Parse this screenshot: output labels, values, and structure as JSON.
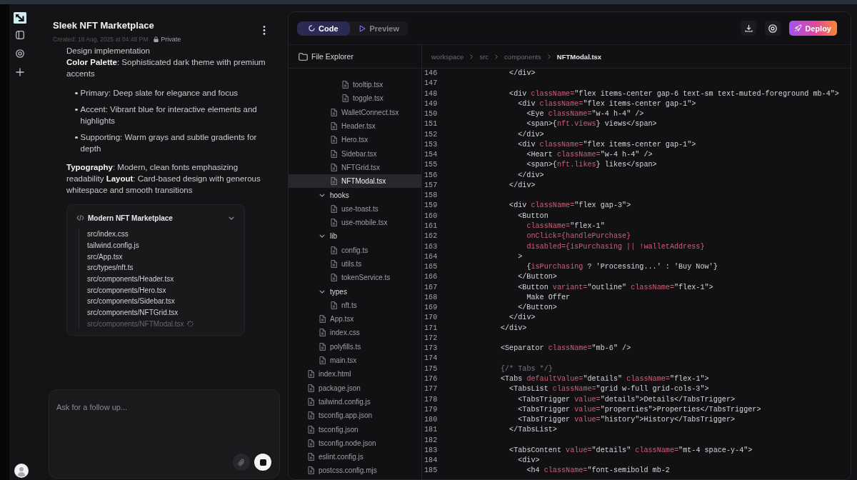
{
  "project": {
    "title": "Sleek NFT Marketplace",
    "created": "Created: 18 Aug, 2025 at 04:48 PM",
    "visibility": "Private"
  },
  "message": {
    "blocks": [
      {
        "kind": "paragraph",
        "text": "Design implementation"
      },
      {
        "kind": "paragraph",
        "text": "**Color Palette**: Sophisticated dark theme with premium accents"
      },
      {
        "kind": "list",
        "items": [
          "Primary: Deep slate for elegance and focus",
          "Accent: Vibrant blue for interactive elements and highlights",
          "Supporting: Warm grays and subtle gradients for depth"
        ]
      },
      {
        "kind": "paragraph",
        "text": "**Typography**: Modern, clean fonts emphasizing readability **Layout**: Card-based design with generous whitespace and smooth transitions"
      }
    ]
  },
  "artifact": {
    "title": "Modern NFT Marketplace",
    "expanded": true,
    "files": [
      {
        "path": "src/index.css",
        "pending": false
      },
      {
        "path": "tailwind.config.js",
        "pending": false
      },
      {
        "path": "src/App.tsx",
        "pending": false
      },
      {
        "path": "src/types/nft.ts",
        "pending": false
      },
      {
        "path": "src/components/Header.tsx",
        "pending": false
      },
      {
        "path": "src/components/Hero.tsx",
        "pending": false
      },
      {
        "path": "src/components/Sidebar.tsx",
        "pending": false
      },
      {
        "path": "src/components/NFTGrid.tsx",
        "pending": false
      },
      {
        "path": "src/components/NFTModal.tsx",
        "pending": true
      }
    ]
  },
  "composer": {
    "placeholder": "Ask for a follow up..."
  },
  "workspace": {
    "tabs": [
      {
        "label": "Code",
        "selected": true
      },
      {
        "label": "Preview",
        "selected": false
      }
    ],
    "deploy": "Deploy"
  },
  "explorer": {
    "title": "File Explorer",
    "tree": [
      {
        "kind": "folder",
        "children": [
          {
            "kind": "folder",
            "children": [
              {
                "kind": "folder",
                "children": [
                  {
                    "kind": "file",
                    "label": "tooltip.tsx",
                    "selected": false
                  },
                  {
                    "kind": "file",
                    "label": "toggle.tsx",
                    "selected": false
                  }
                ]
              },
              {
                "kind": "file",
                "label": "WalletConnect.tsx",
                "selected": false
              },
              {
                "kind": "file",
                "label": "Header.tsx",
                "selected": false
              },
              {
                "kind": "file",
                "label": "Hero.tsx",
                "selected": false
              },
              {
                "kind": "file",
                "label": "Sidebar.tsx",
                "selected": false
              },
              {
                "kind": "file",
                "label": "NFTGrid.tsx",
                "selected": false
              },
              {
                "kind": "file",
                "label": "NFTModal.tsx",
                "selected": true
              }
            ]
          },
          {
            "kind": "folder",
            "label": "hooks",
            "expanded": true,
            "children": [
              {
                "kind": "file",
                "label": "use-toast.ts",
                "selected": false
              },
              {
                "kind": "file",
                "label": "use-mobile.tsx",
                "selected": false
              }
            ]
          },
          {
            "kind": "folder",
            "label": "lib",
            "expanded": true,
            "children": [
              {
                "kind": "file",
                "label": "config.ts",
                "selected": false
              },
              {
                "kind": "file",
                "label": "utils.ts",
                "selected": false
              },
              {
                "kind": "file",
                "label": "tokenService.ts",
                "selected": false
              }
            ]
          },
          {
            "kind": "folder",
            "label": "types",
            "expanded": true,
            "children": [
              {
                "kind": "file",
                "label": "nft.ts",
                "selected": false
              }
            ]
          },
          {
            "kind": "file",
            "label": "App.tsx",
            "selected": false
          },
          {
            "kind": "file",
            "label": "index.css",
            "selected": false
          },
          {
            "kind": "file",
            "label": "polyfills.ts",
            "selected": false
          },
          {
            "kind": "file",
            "label": "main.tsx",
            "selected": false
          }
        ]
      },
      {
        "kind": "file",
        "label": "index.html",
        "selected": false
      },
      {
        "kind": "file",
        "label": "package.json",
        "selected": false
      },
      {
        "kind": "file",
        "label": "tailwind.config.js",
        "selected": false
      },
      {
        "kind": "file",
        "label": "tsconfig.app.json",
        "selected": false
      },
      {
        "kind": "file",
        "label": "tsconfig.json",
        "selected": false
      },
      {
        "kind": "file",
        "label": "tsconfig.node.json",
        "selected": false
      },
      {
        "kind": "file",
        "label": "eslint.config.js",
        "selected": false
      },
      {
        "kind": "file",
        "label": "postcss.config.mjs",
        "selected": false
      }
    ]
  },
  "editor": {
    "breadcrumb": [
      "workspace",
      "src",
      "components",
      "NFTModal.tsx"
    ],
    "lines": [
      {
        "number": "146",
        "tokens": [
          {
            "kind": "plain",
            "text": "              </div>"
          }
        ]
      },
      {
        "number": "147"
      },
      {
        "number": "148",
        "tokens": [
          {
            "kind": "plain",
            "text": "              <div "
          },
          {
            "kind": "attr",
            "text": "className="
          },
          {
            "kind": "plain",
            "text": "\"flex items-center gap-6 text-sm text-muted-foreground mb-4\">"
          }
        ]
      },
      {
        "number": "149",
        "tokens": [
          {
            "kind": "plain",
            "text": "                <div "
          },
          {
            "kind": "attr",
            "text": "className="
          },
          {
            "kind": "plain",
            "text": "\"flex items-center gap-1\">"
          }
        ]
      },
      {
        "number": "150",
        "tokens": [
          {
            "kind": "plain",
            "text": "                  <Eye "
          },
          {
            "kind": "attr",
            "text": "className="
          },
          {
            "kind": "plain",
            "text": "\"w-4 h-4\" />"
          }
        ]
      },
      {
        "number": "151",
        "tokens": [
          {
            "kind": "plain",
            "text": "                  <span>{"
          },
          {
            "kind": "attr",
            "text": "nft.views"
          },
          {
            "kind": "plain",
            "text": "} views</span>"
          }
        ]
      },
      {
        "number": "152",
        "tokens": [
          {
            "kind": "plain",
            "text": "                </div>"
          }
        ]
      },
      {
        "number": "153",
        "tokens": [
          {
            "kind": "plain",
            "text": "                <div "
          },
          {
            "kind": "attr",
            "text": "className="
          },
          {
            "kind": "plain",
            "text": "\"flex items-center gap-1\">"
          }
        ]
      },
      {
        "number": "154",
        "tokens": [
          {
            "kind": "plain",
            "text": "                  <Heart "
          },
          {
            "kind": "attr",
            "text": "className="
          },
          {
            "kind": "plain",
            "text": "\"w-4 h-4\" />"
          }
        ]
      },
      {
        "number": "155",
        "tokens": [
          {
            "kind": "plain",
            "text": "                  <span>{"
          },
          {
            "kind": "attr",
            "text": "nft.likes"
          },
          {
            "kind": "plain",
            "text": "} likes</span>"
          }
        ]
      },
      {
        "number": "156",
        "tokens": [
          {
            "kind": "plain",
            "text": "                </div>"
          }
        ]
      },
      {
        "number": "157",
        "tokens": [
          {
            "kind": "plain",
            "text": "              </div>"
          }
        ]
      },
      {
        "number": "158"
      },
      {
        "number": "159",
        "tokens": [
          {
            "kind": "plain",
            "text": "              <div "
          },
          {
            "kind": "attr",
            "text": "className="
          },
          {
            "kind": "plain",
            "text": "\"flex gap-3\">"
          }
        ]
      },
      {
        "number": "160",
        "tokens": [
          {
            "kind": "plain",
            "text": "                <Button"
          }
        ]
      },
      {
        "number": "161",
        "tokens": [
          {
            "kind": "attr",
            "text": "                  className="
          },
          {
            "kind": "plain",
            "text": "\"flex-1\""
          }
        ]
      },
      {
        "number": "162",
        "tokens": [
          {
            "kind": "attr",
            "text": "                  onClick={handlePurchase}"
          }
        ]
      },
      {
        "number": "163",
        "tokens": [
          {
            "kind": "attr",
            "text": "                  disabled={isPurchasing || !walletAddress}"
          }
        ]
      },
      {
        "number": "164",
        "tokens": [
          {
            "kind": "plain",
            "text": "                >"
          }
        ]
      },
      {
        "number": "165",
        "tokens": [
          {
            "kind": "plain",
            "text": "                  {"
          },
          {
            "kind": "attr",
            "text": "isPurchasing"
          },
          {
            "kind": "plain",
            "text": " ? 'Processing...' : 'Buy Now'}"
          }
        ]
      },
      {
        "number": "166",
        "tokens": [
          {
            "kind": "plain",
            "text": "                </Button>"
          }
        ]
      },
      {
        "number": "167",
        "tokens": [
          {
            "kind": "plain",
            "text": "                <Button "
          },
          {
            "kind": "attr",
            "text": "variant="
          },
          {
            "kind": "plain",
            "text": "\"outline\" "
          },
          {
            "kind": "attr",
            "text": "className="
          },
          {
            "kind": "plain",
            "text": "\"flex-1\">"
          }
        ]
      },
      {
        "number": "168",
        "tokens": [
          {
            "kind": "plain",
            "text": "                  Make Offer"
          }
        ]
      },
      {
        "number": "169",
        "tokens": [
          {
            "kind": "plain",
            "text": "                </Button>"
          }
        ]
      },
      {
        "number": "170",
        "tokens": [
          {
            "kind": "plain",
            "text": "              </div>"
          }
        ]
      },
      {
        "number": "171",
        "tokens": [
          {
            "kind": "plain",
            "text": "            </div>"
          }
        ]
      },
      {
        "number": "172"
      },
      {
        "number": "173",
        "tokens": [
          {
            "kind": "plain",
            "text": "            <Separator "
          },
          {
            "kind": "attr",
            "text": "className="
          },
          {
            "kind": "plain",
            "text": "\"mb-6\" />"
          }
        ]
      },
      {
        "number": "174"
      },
      {
        "number": "175",
        "tokens": [
          {
            "kind": "comment",
            "text": "            {/* Tabs */}"
          }
        ]
      },
      {
        "number": "176",
        "tokens": [
          {
            "kind": "plain",
            "text": "            <Tabs "
          },
          {
            "kind": "attr",
            "text": "defaultValue="
          },
          {
            "kind": "plain",
            "text": "\"details\" "
          },
          {
            "kind": "attr",
            "text": "className="
          },
          {
            "kind": "plain",
            "text": "\"flex-1\">"
          }
        ]
      },
      {
        "number": "177",
        "tokens": [
          {
            "kind": "plain",
            "text": "              <TabsList "
          },
          {
            "kind": "attr",
            "text": "className="
          },
          {
            "kind": "plain",
            "text": "\"grid w-full grid-cols-3\">"
          }
        ]
      },
      {
        "number": "178",
        "tokens": [
          {
            "kind": "plain",
            "text": "                <TabsTrigger "
          },
          {
            "kind": "attr",
            "text": "value="
          },
          {
            "kind": "plain",
            "text": "\"details\">Details</TabsTrigger>"
          }
        ]
      },
      {
        "number": "179",
        "tokens": [
          {
            "kind": "plain",
            "text": "                <TabsTrigger "
          },
          {
            "kind": "attr",
            "text": "value="
          },
          {
            "kind": "plain",
            "text": "\"properties\">Properties</TabsTrigger>"
          }
        ]
      },
      {
        "number": "180",
        "tokens": [
          {
            "kind": "plain",
            "text": "                <TabsTrigger "
          },
          {
            "kind": "attr",
            "text": "value="
          },
          {
            "kind": "plain",
            "text": "\"history\">History</TabsTrigger>"
          }
        ]
      },
      {
        "number": "181",
        "tokens": [
          {
            "kind": "plain",
            "text": "              </TabsList>"
          }
        ]
      },
      {
        "number": "182"
      },
      {
        "number": "183",
        "tokens": [
          {
            "kind": "plain",
            "text": "              <TabsContent "
          },
          {
            "kind": "attr",
            "text": "value="
          },
          {
            "kind": "plain",
            "text": "\"details\" "
          },
          {
            "kind": "attr",
            "text": "className="
          },
          {
            "kind": "plain",
            "text": "\"mt-4 space-y-4\">"
          }
        ]
      },
      {
        "number": "184",
        "tokens": [
          {
            "kind": "plain",
            "text": "                <div>"
          }
        ]
      },
      {
        "number": "185",
        "tokens": [
          {
            "kind": "plain",
            "text": "                  <h4 "
          },
          {
            "kind": "attr",
            "text": "className="
          },
          {
            "kind": "plain",
            "text": "\"font-semibold mb-2"
          }
        ]
      }
    ]
  }
}
